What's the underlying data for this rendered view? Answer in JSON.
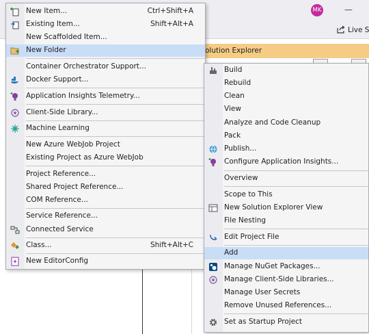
{
  "header": {
    "avatar_initials": "MK",
    "minimize_glyph": "—",
    "live_share_label": "Live Sh"
  },
  "solution_explorer": {
    "title": "olution Explorer"
  },
  "add_menu": {
    "items": [
      {
        "label": "New Item...",
        "shortcut": "Ctrl+Shift+A",
        "icon": "new-item-icon"
      },
      {
        "label": "Existing Item...",
        "shortcut": "Shift+Alt+A",
        "icon": "existing-item-icon"
      },
      {
        "label": "New Scaffolded Item...",
        "shortcut": "",
        "icon": ""
      },
      {
        "label": "New Folder",
        "shortcut": "",
        "icon": "folder-icon",
        "highlighted": true
      },
      {
        "label": "Container Orchestrator Support...",
        "shortcut": "",
        "icon": ""
      },
      {
        "label": "Docker Support...",
        "shortcut": "",
        "icon": "docker-icon"
      },
      {
        "label": "Application Insights Telemetry...",
        "shortcut": "",
        "icon": "app-insights-icon"
      },
      {
        "label": "Client-Side Library...",
        "shortcut": "",
        "icon": "library-icon"
      },
      {
        "label": "Machine Learning",
        "shortcut": "",
        "icon": "machine-learning-icon"
      },
      {
        "label": "New Azure WebJob Project",
        "shortcut": "",
        "icon": ""
      },
      {
        "label": "Existing Project as Azure WebJob",
        "shortcut": "",
        "icon": ""
      },
      {
        "label": "Project Reference...",
        "shortcut": "",
        "icon": ""
      },
      {
        "label": "Shared Project Reference...",
        "shortcut": "",
        "icon": ""
      },
      {
        "label": "COM Reference...",
        "shortcut": "",
        "icon": ""
      },
      {
        "label": "Service Reference...",
        "shortcut": "",
        "icon": ""
      },
      {
        "label": "Connected Service",
        "shortcut": "",
        "icon": "connected-service-icon"
      },
      {
        "label": "Class...",
        "shortcut": "Shift+Alt+C",
        "icon": "class-icon"
      },
      {
        "label": "New EditorConfig",
        "shortcut": "",
        "icon": "editorconfig-icon"
      }
    ]
  },
  "project_menu": {
    "items": [
      {
        "label": "Build",
        "icon": "build-icon"
      },
      {
        "label": "Rebuild",
        "icon": ""
      },
      {
        "label": "Clean",
        "icon": ""
      },
      {
        "label": "View",
        "icon": ""
      },
      {
        "label": "Analyze and Code Cleanup",
        "icon": ""
      },
      {
        "label": "Pack",
        "icon": ""
      },
      {
        "label": "Publish...",
        "icon": "publish-icon"
      },
      {
        "label": "Configure Application Insights...",
        "icon": "app-insights-icon"
      },
      {
        "label": "Overview",
        "icon": ""
      },
      {
        "label": "Scope to This",
        "icon": ""
      },
      {
        "label": "New Solution Explorer View",
        "icon": "new-view-icon"
      },
      {
        "label": "File Nesting",
        "icon": ""
      },
      {
        "label": "Edit Project File",
        "icon": "edit-project-icon"
      },
      {
        "label": "Add",
        "icon": "",
        "highlighted": true
      },
      {
        "label": "Manage NuGet Packages...",
        "icon": "nuget-icon"
      },
      {
        "label": "Manage Client-Side Libraries...",
        "icon": "library-icon"
      },
      {
        "label": "Manage User Secrets",
        "icon": ""
      },
      {
        "label": "Remove Unused References...",
        "icon": ""
      },
      {
        "label": "Set as Startup Project",
        "icon": "gear-icon"
      }
    ]
  }
}
